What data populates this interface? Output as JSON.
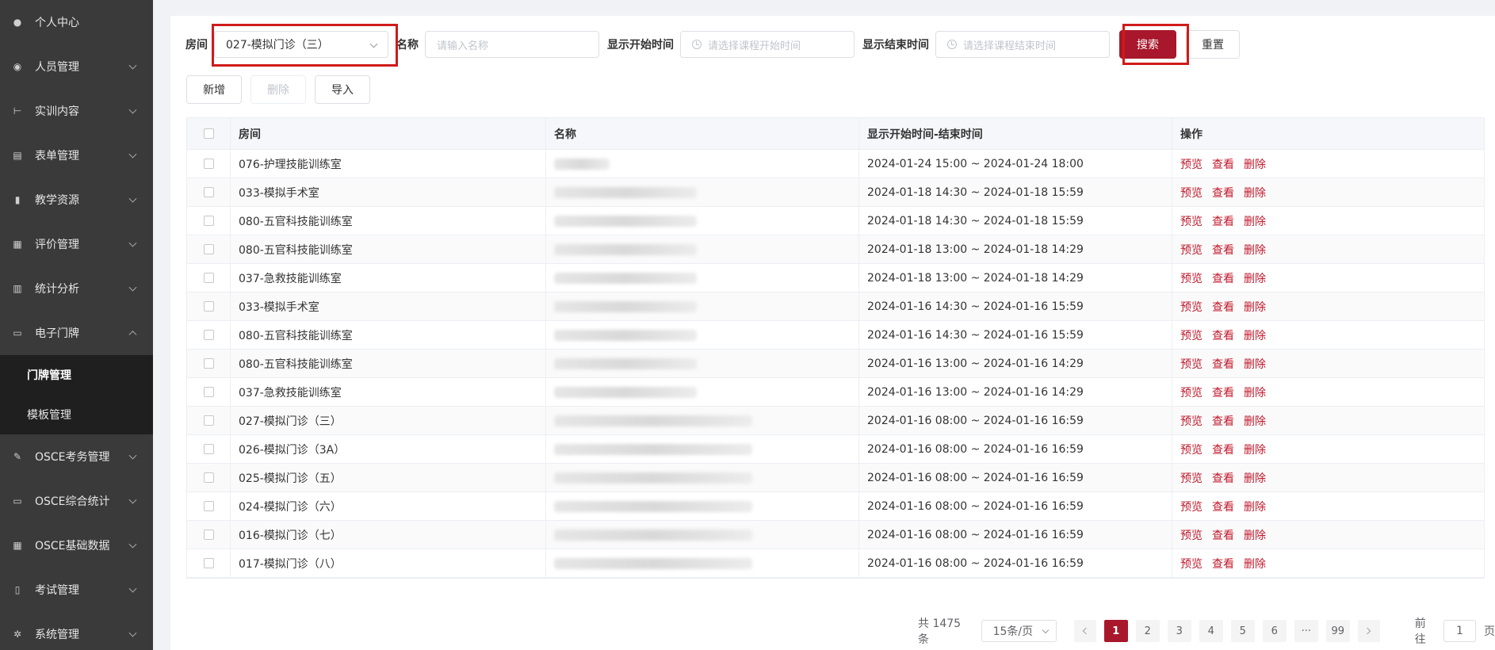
{
  "sidebar": {
    "items": [
      {
        "label": "个人中心",
        "icon": "user-icon"
      },
      {
        "label": "人员管理",
        "icon": "users-icon"
      },
      {
        "label": "实训内容",
        "icon": "tree-icon"
      },
      {
        "label": "表单管理",
        "icon": "form-icon"
      },
      {
        "label": "教学资源",
        "icon": "book-icon"
      },
      {
        "label": "评价管理",
        "icon": "rating-icon"
      },
      {
        "label": "统计分析",
        "icon": "bar-chart-icon"
      },
      {
        "label": "电子门牌",
        "icon": "monitor-icon"
      }
    ],
    "subitems": [
      {
        "label": "门牌管理"
      },
      {
        "label": "模板管理"
      }
    ],
    "items_after": [
      {
        "label": "OSCE考务管理",
        "icon": "edit-icon"
      },
      {
        "label": "OSCE综合统计",
        "icon": "monitor-icon"
      },
      {
        "label": "OSCE基础数据",
        "icon": "grid-icon"
      },
      {
        "label": "考试管理",
        "icon": "book-open-icon"
      },
      {
        "label": "系统管理",
        "icon": "gear-icon"
      }
    ]
  },
  "filters": {
    "room_label": "房间",
    "room_value": "027-模拟门诊（三）",
    "name_label": "名称",
    "name_placeholder": "请输入名称",
    "start_label": "显示开始时间",
    "start_placeholder": "请选择课程开始时间",
    "end_label": "显示结束时间",
    "end_placeholder": "请选择课程结束时间",
    "search_label": "搜索",
    "reset_label": "重置"
  },
  "actions": {
    "add_label": "新增",
    "delete_label": "删除",
    "import_label": "导入"
  },
  "table": {
    "headers": {
      "room": "房间",
      "name": "名称",
      "time": "显示开始时间-结束时间",
      "ops": "操作"
    },
    "ops": {
      "preview": "预览",
      "view": "查看",
      "delete": "删除"
    },
    "rows": [
      {
        "room": "076-护理技能训练室",
        "time": "2024-01-24 15:00 ~ 2024-01-24 18:00"
      },
      {
        "room": "033-模拟手术室",
        "time": "2024-01-18 14:30 ~ 2024-01-18 15:59"
      },
      {
        "room": "080-五官科技能训练室",
        "time": "2024-01-18 14:30 ~ 2024-01-18 15:59"
      },
      {
        "room": "080-五官科技能训练室",
        "time": "2024-01-18 13:00 ~ 2024-01-18 14:29"
      },
      {
        "room": "037-急救技能训练室",
        "time": "2024-01-18 13:00 ~ 2024-01-18 14:29"
      },
      {
        "room": "033-模拟手术室",
        "time": "2024-01-16 14:30 ~ 2024-01-16 15:59"
      },
      {
        "room": "080-五官科技能训练室",
        "time": "2024-01-16 14:30 ~ 2024-01-16 15:59"
      },
      {
        "room": "080-五官科技能训练室",
        "time": "2024-01-16 13:00 ~ 2024-01-16 14:29"
      },
      {
        "room": "037-急救技能训练室",
        "time": "2024-01-16 13:00 ~ 2024-01-16 14:29"
      },
      {
        "room": "027-模拟门诊（三）",
        "time": "2024-01-16 08:00 ~ 2024-01-16 16:59"
      },
      {
        "room": "026-模拟门诊（3A）",
        "time": "2024-01-16 08:00 ~ 2024-01-16 16:59"
      },
      {
        "room": "025-模拟门诊（五）",
        "time": "2024-01-16 08:00 ~ 2024-01-16 16:59"
      },
      {
        "room": "024-模拟门诊（六）",
        "time": "2024-01-16 08:00 ~ 2024-01-16 16:59"
      },
      {
        "room": "016-模拟门诊（七）",
        "time": "2024-01-16 08:00 ~ 2024-01-16 16:59"
      },
      {
        "room": "017-模拟门诊（八）",
        "time": "2024-01-16 08:00 ~ 2024-01-16 16:59"
      }
    ]
  },
  "pagination": {
    "total_text": "共 1475 条",
    "page_size": "15条/页",
    "pages": [
      "1",
      "2",
      "3",
      "4",
      "5",
      "6",
      "···",
      "99"
    ],
    "goto_prefix": "前往",
    "goto_value": "1",
    "goto_suffix": "页"
  },
  "colors": {
    "accent": "#a8172b",
    "sidebar_bg": "#3a3a3a",
    "highlight": "#d01a1a"
  }
}
